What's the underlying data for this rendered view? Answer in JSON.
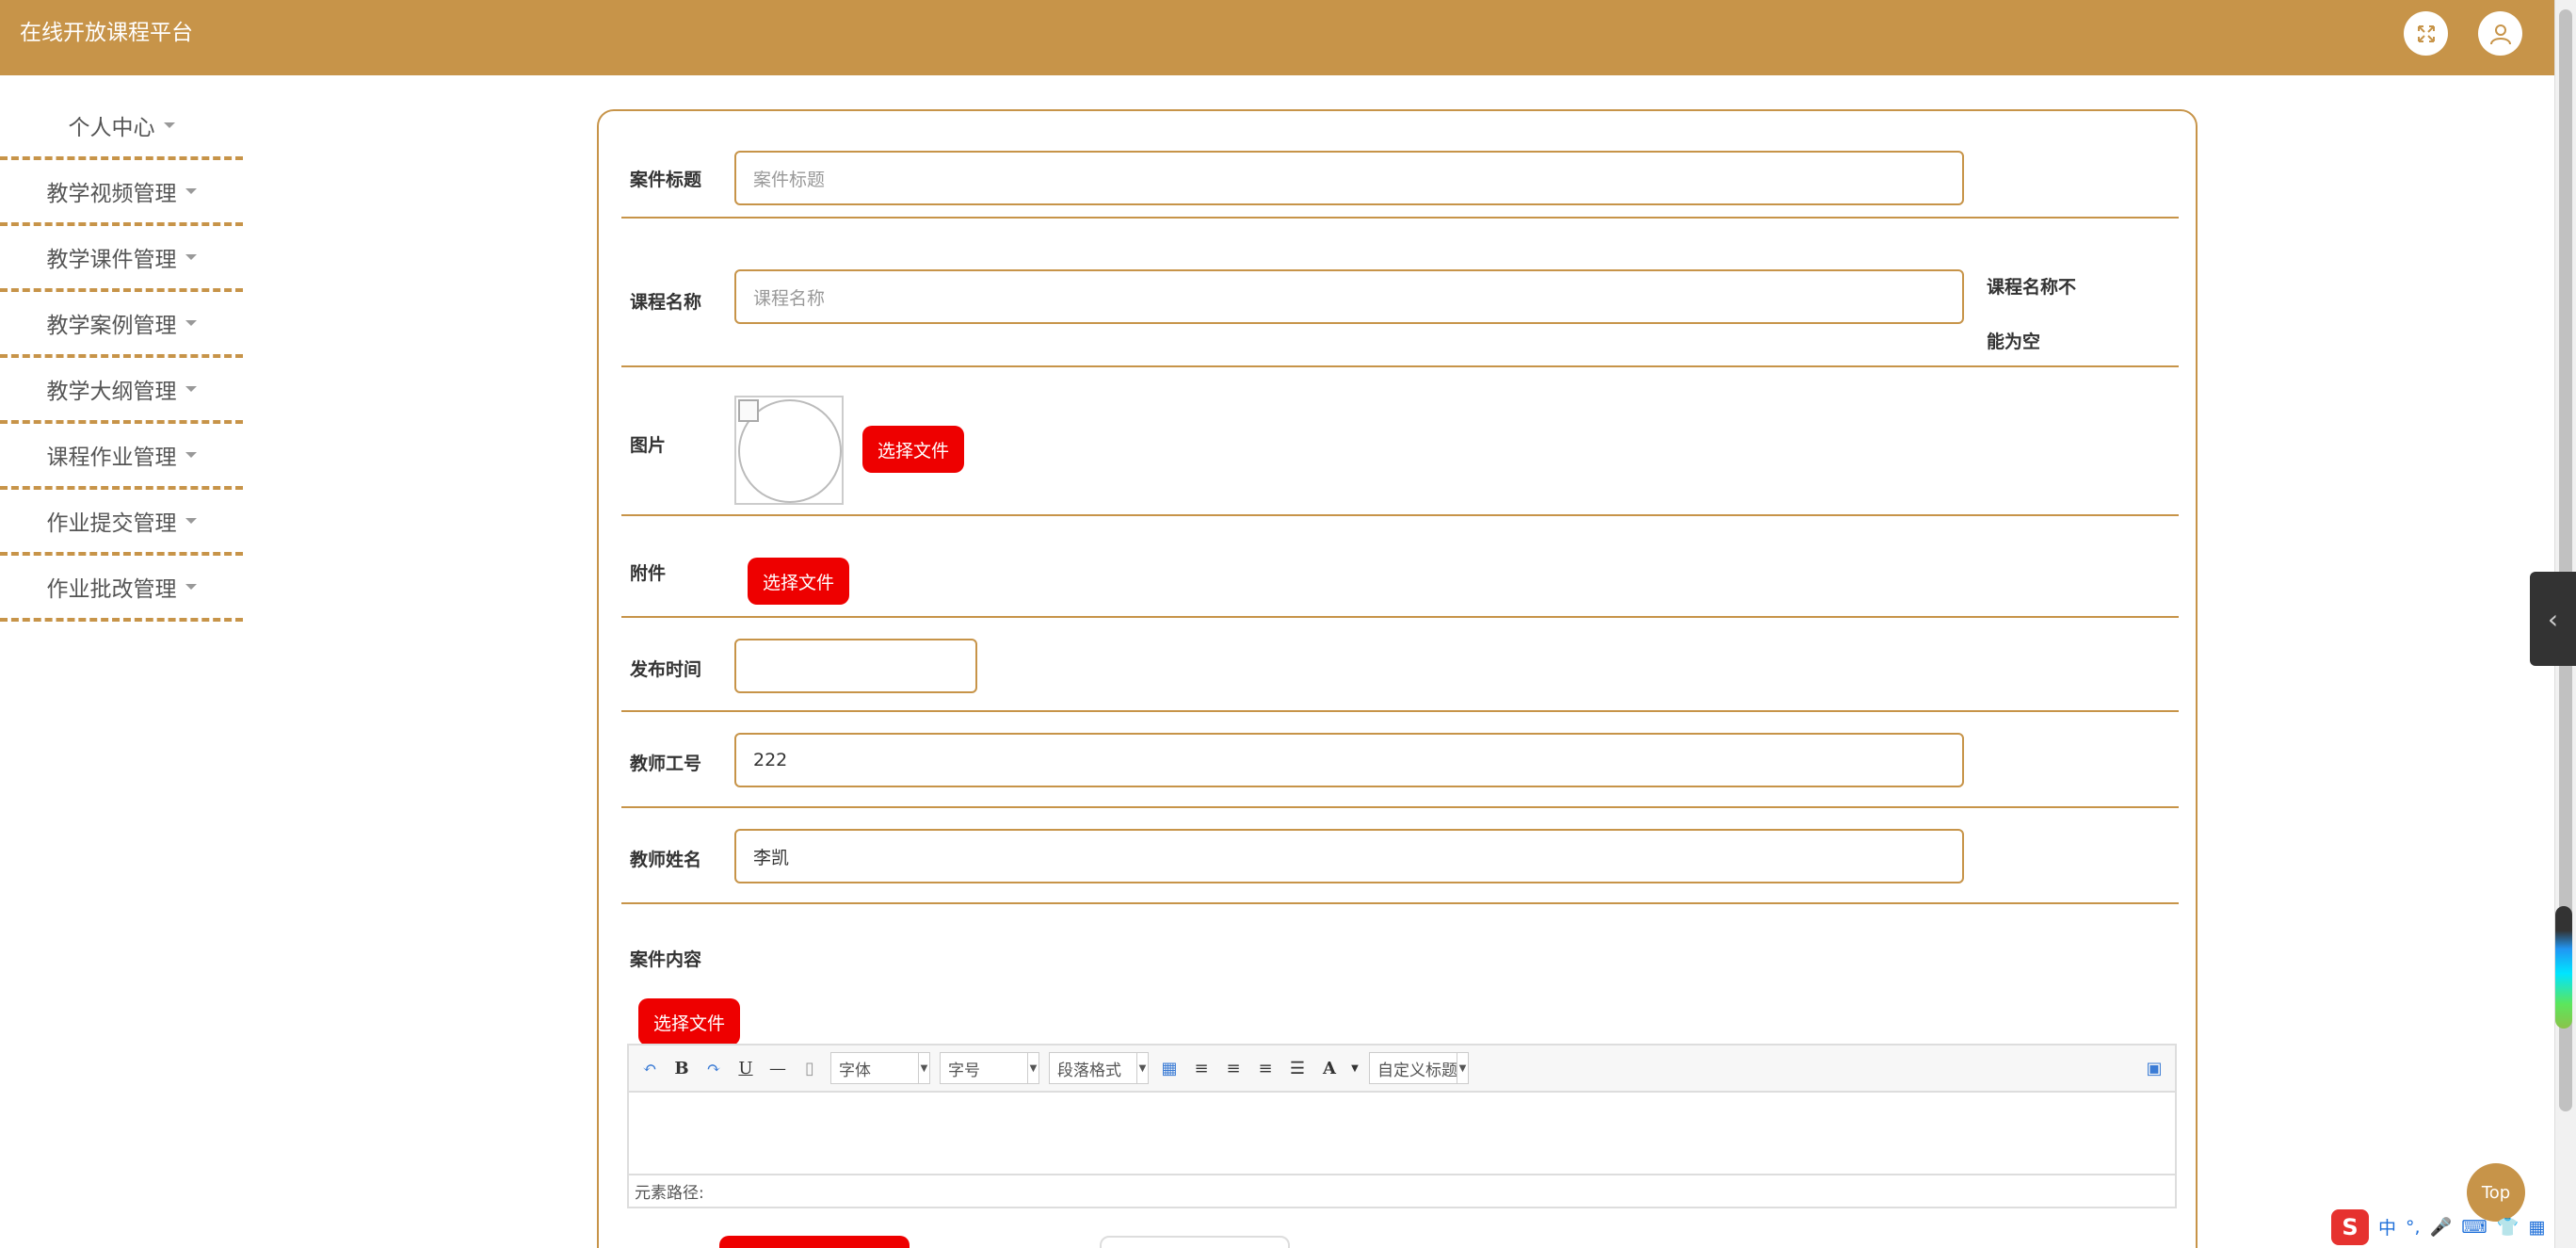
{
  "header": {
    "title": "在线开放课程平台"
  },
  "sidebar": {
    "items": [
      {
        "label": "个人中心"
      },
      {
        "label": "教学视频管理"
      },
      {
        "label": "教学课件管理"
      },
      {
        "label": "教学案例管理"
      },
      {
        "label": "教学大纲管理"
      },
      {
        "label": "课程作业管理"
      },
      {
        "label": "作业提交管理"
      },
      {
        "label": "作业批改管理"
      }
    ]
  },
  "form": {
    "case_title": {
      "label": "案件标题",
      "placeholder": "案件标题",
      "value": ""
    },
    "course_name": {
      "label": "课程名称",
      "placeholder": "课程名称",
      "value": "",
      "error": "课程名称不能为空"
    },
    "image": {
      "label": "图片",
      "button": "选择文件"
    },
    "attachment": {
      "label": "附件",
      "button": "选择文件"
    },
    "publish_time": {
      "label": "发布时间",
      "value": ""
    },
    "teacher_id": {
      "label": "教师工号",
      "value": "222"
    },
    "teacher_name": {
      "label": "教师姓名",
      "value": "李凯"
    },
    "case_content": {
      "label": "案件内容",
      "button": "选择文件"
    }
  },
  "editor": {
    "font_family": "字体",
    "font_size": "字号",
    "paragraph": "段落格式",
    "custom_title": "自定义标题",
    "path_label": "元素路径:"
  },
  "top_button": "Top",
  "ime": {
    "mode": "中"
  },
  "colors": {
    "brand": "#c79449",
    "danger": "#ee0000"
  }
}
